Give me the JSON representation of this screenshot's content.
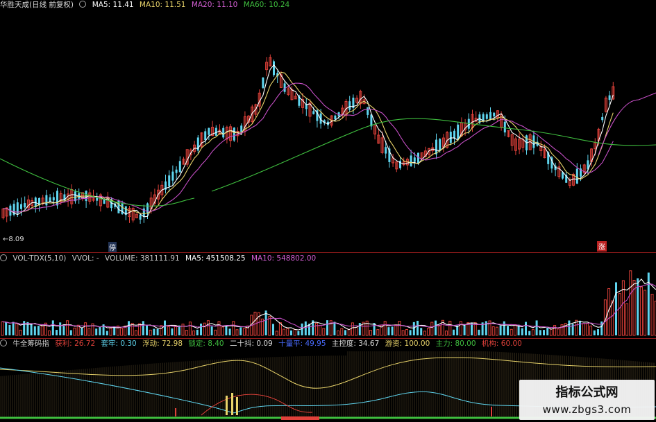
{
  "price_header": {
    "title": "华胜天成(日线 前复权)",
    "ma5": "MA5: 11.41",
    "ma10": "MA10: 11.51",
    "ma20": "MA20: 11.10",
    "ma60": "MA60: 10.24"
  },
  "vol_header": {
    "indicator": "VOL-TDX(5,10)",
    "vvol": "VVOL: -",
    "volume": "VOLUME: 381111.91",
    "ma5": "MA5: 451508.25",
    "ma10": "MA10: 548802.00"
  },
  "chip_header": {
    "indicator": "牛全筹码指",
    "profit": "获利: 26.72",
    "trapped": "套牢: 0.30",
    "floating": "浮动: 72.98",
    "locked": "锁定: 8.40",
    "twenty": "二十抖: 0.09",
    "ten": "十量平: 49.95",
    "control": "主控度: 34.67",
    "free": "游资: 100.00",
    "main": "主力: 80.00",
    "inst": "机构: 60.00"
  },
  "annotations": {
    "low_price": "←8.09",
    "stop_badge": "停",
    "up_badge": "涨"
  },
  "watermark": {
    "title": "指标公式网",
    "url": "www.zbgs3.com"
  },
  "colors": {
    "up": "#e0413a",
    "down": "#5fd5ef",
    "ma5": "#ffffff",
    "ma10": "#e8d36a",
    "ma20": "#c64fc6",
    "ma60": "#3fbf3f",
    "separator": "#8a1a1a"
  }
}
